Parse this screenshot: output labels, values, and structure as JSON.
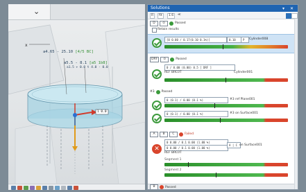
{
  "viewport": {
    "dim_label_1": "a4.65 - 25.10",
    "dim_label_1_tag": "[4/5 BC]",
    "dim_label_2": "a5.5 - 8.1",
    "dim_label_2_tag": "[a5 1b8]",
    "dim_label_2_sub": "a1.5 + 0.0 t 4.0 · 0.0",
    "axis_label": "x",
    "box_label": "1 0.0"
  },
  "panel": {
    "title": "Solutions",
    "toolbar_items": [
      "R",
      "fit",
      "1.6",
      "≪"
    ],
    "retain_results_label": "Retain results",
    "section1_status": "Passed",
    "section1_readout": "[0 0.00 / 0.17(0.10 0.1%)]",
    "section1_count": "0.10",
    "section1_target": "Cylinder008",
    "section2_tag": "DRF",
    "section2_status": "Passed",
    "section2_readout": "0 / 0.00 (0.00) 0.5 [ DRF ]",
    "section2_label": "REF BRC0T",
    "section2_target": "Cylinder001",
    "section3_tag": "#3",
    "section3_status": "Passed",
    "section3_readout": "0 (0.1) / 0.00 (0.1 %)",
    "section3_ref": "#3 ref Plane001",
    "section3_readout2": "0 (0.1) / 0.00 (0.1 %)",
    "section3_ref2": "#3 on Surface001",
    "section4_tags": [
      "A",
      "B",
      "C"
    ],
    "section4_status": "Failed",
    "section4_readout": "0 0.00 / 0.1 0.00 (1.00 %)",
    "section4_readout2": "0 0.00 / 0.1 0.00 (1.00 %)",
    "section4_right": "A | C",
    "section4_label": "REF BRC0T",
    "section4_target": "on Surface001",
    "segment1": "Segment 1",
    "segment2": "Segment 2",
    "section5_tag": "B",
    "section5_status": "Passed"
  }
}
